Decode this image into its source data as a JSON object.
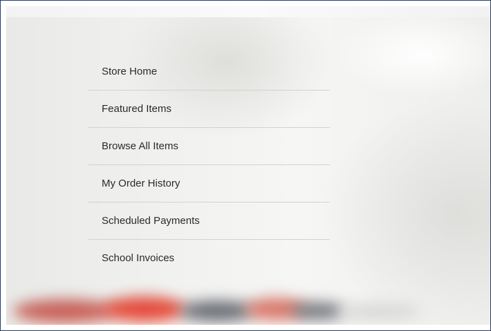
{
  "menu": {
    "items": [
      {
        "label": "Store Home"
      },
      {
        "label": "Featured Items"
      },
      {
        "label": "Browse All Items"
      },
      {
        "label": "My Order History"
      },
      {
        "label": "Scheduled Payments"
      },
      {
        "label": "School Invoices"
      }
    ]
  }
}
